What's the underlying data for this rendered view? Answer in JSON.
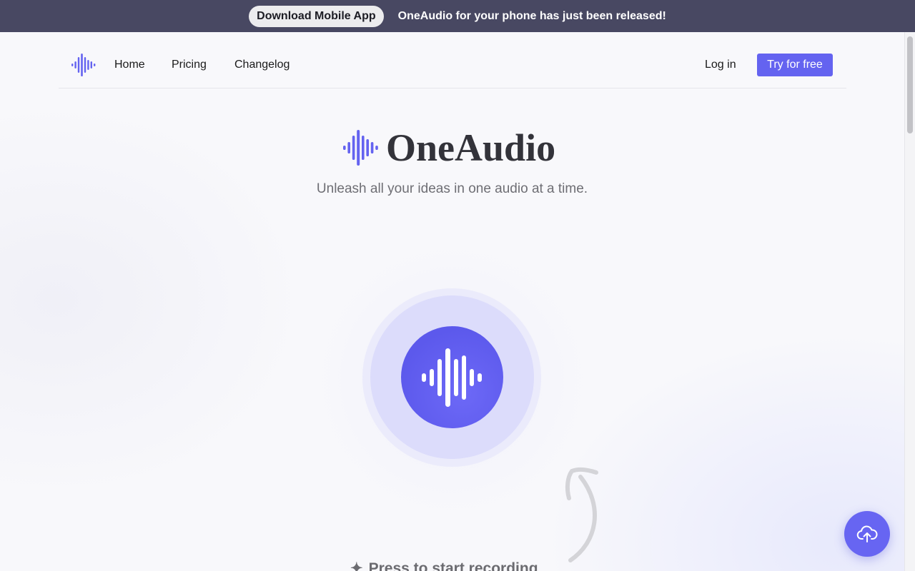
{
  "banner": {
    "button_label": "Download Mobile App",
    "message": "OneAudio for your phone has just been released!"
  },
  "nav": {
    "logo_icon": "audio-wave-icon",
    "links": [
      "Home",
      "Pricing",
      "Changelog"
    ],
    "login_label": "Log in",
    "cta_label": "Try for free"
  },
  "hero": {
    "title": "OneAudio",
    "subtitle": "Unleash all your ideas in one audio at a time."
  },
  "recorder": {
    "button_icon": "audio-wave-icon",
    "prompt": "Press to start recording",
    "prompt_icon": "sparkle-icon"
  },
  "upload": {
    "icon": "cloud-upload-icon"
  },
  "colors": {
    "accent": "#6463f0",
    "banner_bg": "#484862",
    "record_ring": "#dcdcfb"
  }
}
